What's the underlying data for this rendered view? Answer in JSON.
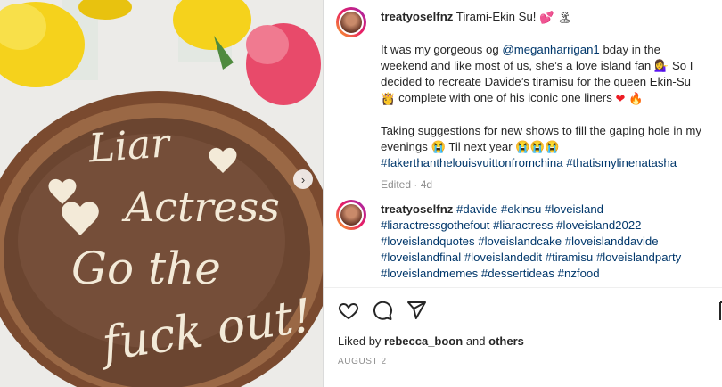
{
  "photo": {
    "cake_lines": [
      "Liar",
      "Actress",
      "Go the",
      "fuck out!"
    ],
    "next_icon": "chevron-right-icon"
  },
  "caption": {
    "username": "treatyoselfnz",
    "title": "Tirami-Ekin Su!",
    "line1_pre": "It was my gorgeous og ",
    "mention": "@meganharrigan1",
    "line1_post": " bday in the",
    "line2": "weekend and like most of us, she’s a love island fan",
    "line2_end": " So I",
    "line3": "decided to recreate Davide’s tiramisu for the queen Ekin-Su",
    "line4": "complete with one of his iconic one liners",
    "line5": "Taking suggestions for new shows to fill the gaping hole in my",
    "line6": "evenings",
    "line6_post": " Til next year",
    "hashtags": "#fakerthanthelouisvuittonfromchina #thatismylinenatasha",
    "edited": "Edited · 4d"
  },
  "comment": {
    "username": "treatyoselfnz",
    "lines": [
      "#davide #ekinsu #loveisland",
      "#liaractressgothefout #liaractress #loveisland2022",
      "#loveislandquotes #loveislandcake #loveislanddavide",
      "#loveislandfinal #loveislandedit #tiramisu #loveislandparty",
      "#loveislandmemes #dessertideas #nzfood"
    ]
  },
  "likes": {
    "prefix": "Liked by ",
    "user": "rebecca_boon",
    "middle": " and ",
    "others": "others"
  },
  "date": "AUGUST 2",
  "colors": {
    "link": "#00376b",
    "heart": "#ed1c24",
    "muted": "#8e8e8e"
  }
}
